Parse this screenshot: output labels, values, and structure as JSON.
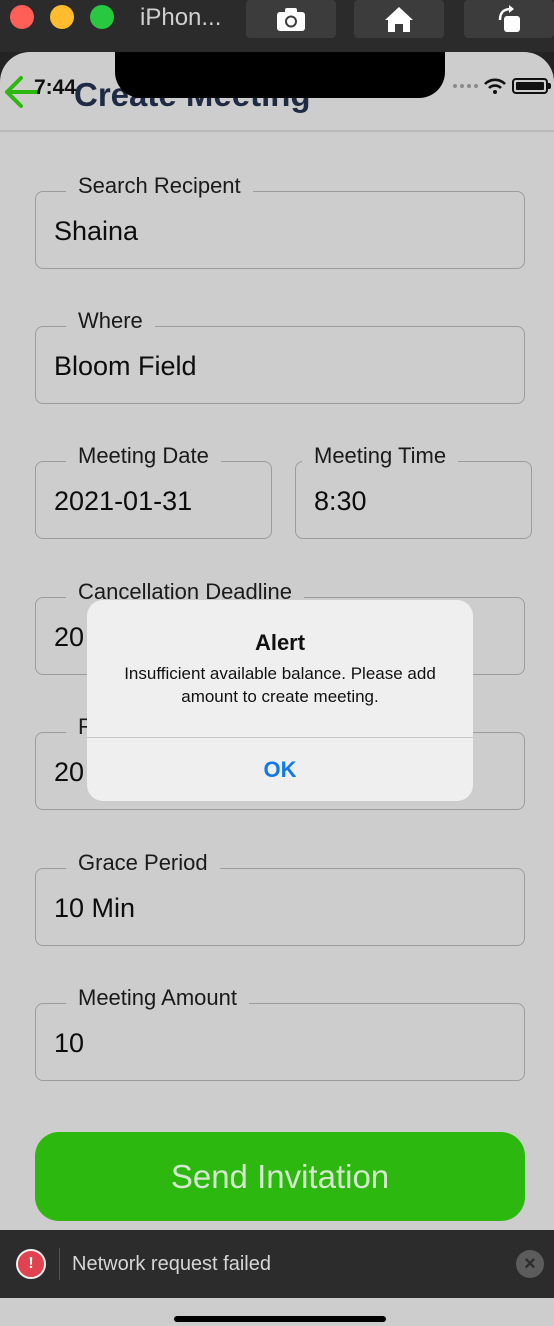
{
  "simulator": {
    "title": "iPhon...",
    "buttons": [
      "screenshot-icon",
      "home-icon",
      "rotate-icon"
    ]
  },
  "status_bar": {
    "time": "7:44"
  },
  "header": {
    "title": "Create Meeting"
  },
  "fields": {
    "recipient": {
      "label": "Search Recipent",
      "value": "Shaina"
    },
    "where": {
      "label": "Where",
      "value": "Bloom Field"
    },
    "meeting_date": {
      "label": "Meeting Date",
      "value": "2021-01-31"
    },
    "meeting_time": {
      "label": "Meeting Time",
      "value": "8:30"
    },
    "cancellation": {
      "label": "Cancellation Deadline",
      "value": "20"
    },
    "response": {
      "label": "R",
      "value": "20"
    },
    "grace_period": {
      "label": "Grace Period",
      "value": "10 Min"
    },
    "amount": {
      "label": "Meeting Amount",
      "value": "10"
    }
  },
  "send_button": {
    "label": "Send Invitation"
  },
  "alert": {
    "title": "Alert",
    "message": "Insufficient available balance. Please add amount to create meeting.",
    "ok_label": "OK"
  },
  "toast": {
    "icon": "!",
    "message": "Network request failed",
    "close_label": "×"
  },
  "colors": {
    "accent_green": "#2cb80e",
    "alert_blue": "#1279e6",
    "error_red": "#e04250"
  }
}
